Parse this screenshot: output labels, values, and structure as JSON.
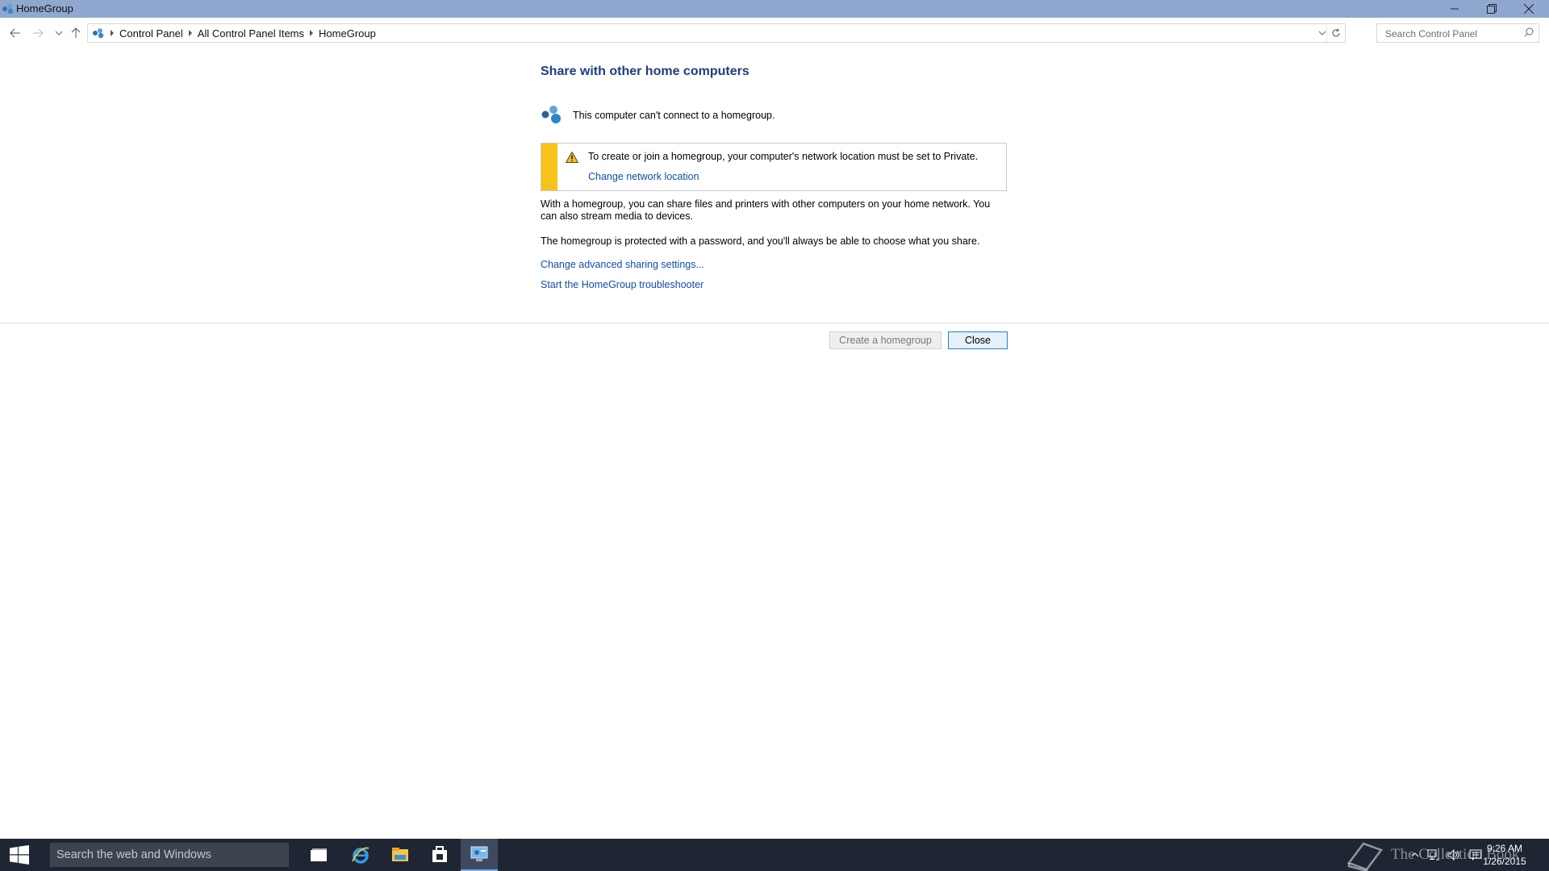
{
  "window": {
    "title": "HomeGroup"
  },
  "address": {
    "crumbs": [
      "Control Panel",
      "All Control Panel Items",
      "HomeGroup"
    ]
  },
  "search": {
    "placeholder": "Search Control Panel"
  },
  "content": {
    "heading": "Share with other home computers",
    "status_text": "This computer can't connect to a homegroup.",
    "warning_text": "To create or join a homegroup, your computer's network location must be set to Private.",
    "warning_link": "Change network location",
    "para1": "With a homegroup, you can share files and printers with other computers on your home network. You can also stream media to devices.",
    "para2": "The homegroup is protected with a password, and you'll always be able to choose what you share.",
    "link_advanced": "Change advanced sharing settings...",
    "link_troubleshooter": "Start the HomeGroup troubleshooter"
  },
  "buttons": {
    "create": "Create a homegroup",
    "close": "Close"
  },
  "taskbar": {
    "search_placeholder": "Search the web and Windows",
    "time": "9:26 AM",
    "date": "1/26/2015",
    "watermark": "The Collection Book"
  },
  "colors": {
    "titlebar": "#8fa8d0",
    "heading": "#1e3e7e",
    "link": "#0f4fa8",
    "warning_stripe": "#f7c21a",
    "taskbar": "#1f2633"
  }
}
